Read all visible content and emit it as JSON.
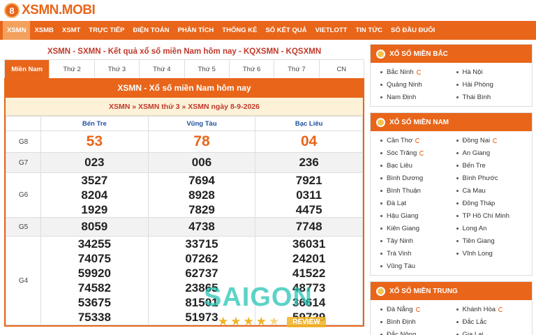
{
  "logo": {
    "badge": "8",
    "text": "XSMN.MOBI"
  },
  "nav": [
    "XSMN",
    "XSMB",
    "XSMT",
    "TRỰC TIẾP",
    "ĐIỆN TOÁN",
    "PHÂN TÍCH",
    "THỐNG KÊ",
    "SỐ KẾT QUẢ",
    "VIETLOTT",
    "TIN TỨC",
    "SỔ ĐẦU ĐUÔI"
  ],
  "page_title": "XSMN - SXMN - Kết quả xổ số miền Nam hôm nay - KQXSMN - KQSXMN",
  "tabs": [
    "Miền Nam",
    "Thứ 2",
    "Thứ 3",
    "Thứ 4",
    "Thứ 5",
    "Thứ 6",
    "Thứ 7",
    "CN"
  ],
  "box_title": "XSMN - Xổ số miền Nam hôm nay",
  "breadcrumb": [
    "XSMN",
    "XSMN thứ 3",
    "XSMN ngày 8-9-2026"
  ],
  "breadcrumb_sep": "»",
  "provinces": [
    "Bến Tre",
    "Vũng Tàu",
    "Bạc Liêu"
  ],
  "results": {
    "g8": {
      "label": "G8",
      "values": [
        "53",
        "78",
        "04"
      ]
    },
    "g7": {
      "label": "G7",
      "values": [
        "023",
        "006",
        "236"
      ]
    },
    "g6": {
      "label": "G6",
      "values": [
        [
          "3527",
          "8204",
          "1929"
        ],
        [
          "7694",
          "8928",
          "7829"
        ],
        [
          "7921",
          "0311",
          "4475"
        ]
      ]
    },
    "g5": {
      "label": "G5",
      "values": [
        "8059",
        "4738",
        "7748"
      ]
    },
    "g4": {
      "label": "G4",
      "values": [
        [
          "34255",
          "74075",
          "59920",
          "74582",
          "53675",
          "75338"
        ],
        [
          "33715",
          "07262",
          "62737",
          "23865",
          "81501",
          "51973"
        ],
        [
          "36031",
          "24201",
          "41522",
          "48773",
          "36614",
          "59729"
        ]
      ]
    }
  },
  "sidebar": {
    "north": {
      "title": "XỔ SỐ MIỀN BẮC",
      "items": [
        "Bắc Ninh",
        "Hà Nội",
        "Quảng Ninh",
        "Hải Phòng",
        "Nam Định",
        "Thái Bình"
      ]
    },
    "south": {
      "title": "XỔ SỐ MIỀN NAM",
      "items": [
        "Cần Thơ",
        "Đồng Nai",
        "Sóc Trăng",
        "An Giang",
        "Bạc Liêu",
        "Bến Tre",
        "Bình Dương",
        "Bình Phước",
        "Bình Thuận",
        "Cà Mau",
        "Đà Lạt",
        "Đồng Tháp",
        "Hậu Giang",
        "TP Hồ Chí Minh",
        "Kiên Giang",
        "Long An",
        "Tây Ninh",
        "Tiền Giang",
        "Trà Vinh",
        "Vĩnh Long",
        "Vũng Tàu"
      ]
    },
    "central": {
      "title": "XỔ SỐ MIỀN TRUNG",
      "items": [
        "Đà Nẵng",
        "Khánh Hòa",
        "Bình Định",
        "Đắc Lắc",
        "Đắc Nông",
        "Gia Lai"
      ]
    }
  },
  "watermark": {
    "text": "SAIGON",
    "badge": "REVIEW",
    "stars": 4.5
  }
}
